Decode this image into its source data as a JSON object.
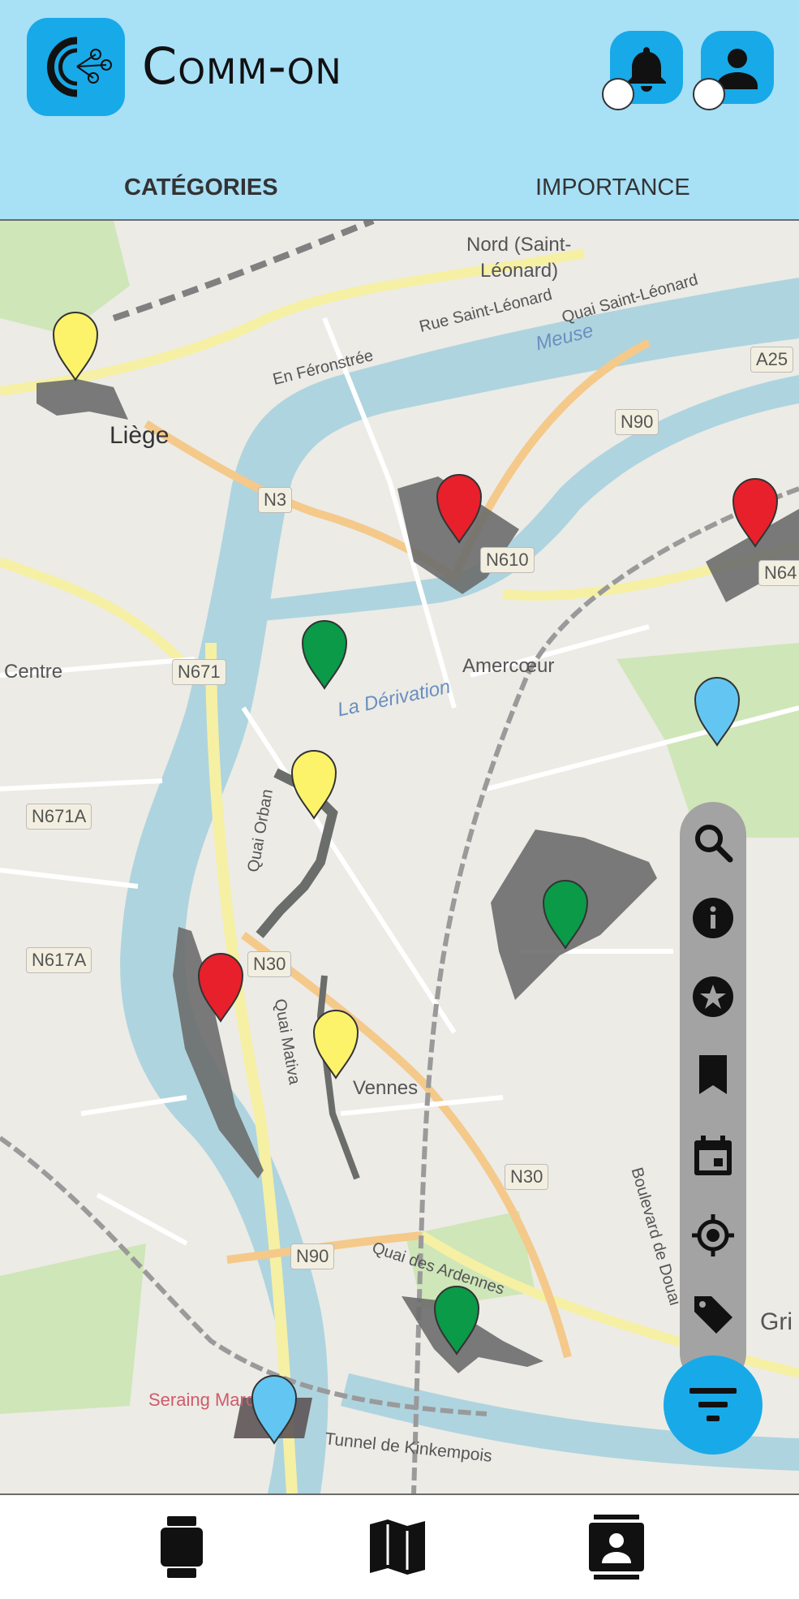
{
  "app": {
    "title": "Comm-on"
  },
  "header": {
    "tabs": [
      {
        "label": "Catégories",
        "active": true
      },
      {
        "label": "Importance",
        "active": false
      }
    ]
  },
  "map": {
    "labels": {
      "liege": "Liège",
      "centre": "Centre",
      "nord": "Nord (Saint-",
      "nord2": "Léonard)",
      "amercoeur": "Amercœur",
      "vennes": "Vennes",
      "derivation": "La Dérivation",
      "meuse": "Meuse",
      "quai_orban": "Quai Orban",
      "quai_mativa": "Quai Mativa",
      "rue_st_leonard": "Rue Saint-Léonard",
      "quai_st_leonard": "Quai Saint-Léonard",
      "en_feronstree": "En Féronstrée",
      "seraing": "Seraing March",
      "tunnel": "Tunnel de Kinkempois",
      "boulevard_douai": "Boulevard de Douai",
      "quai_ardennes": "Quai des Ardennes",
      "gri": "Gri"
    },
    "roads": [
      "A25",
      "N90",
      "N3",
      "N610",
      "N671",
      "N671A",
      "N617A",
      "N30",
      "N30",
      "N90",
      "N64"
    ],
    "marker_colors": {
      "yellow": "#fdf36a",
      "red": "#e8202b",
      "green": "#0a9a48",
      "blue": "#63c6f2"
    },
    "markers": [
      "yellow",
      "red",
      "red",
      "green",
      "blue",
      "yellow",
      "green",
      "red",
      "yellow",
      "green",
      "blue"
    ]
  },
  "tools": [
    "search-icon",
    "info-icon",
    "star-icon",
    "bookmark-icon",
    "calendar-icon",
    "target-icon",
    "tag-icon"
  ],
  "bottom_nav": [
    "watch-icon",
    "map-icon",
    "contact-card-icon"
  ],
  "colors": {
    "accent": "#18a9e8",
    "header_bg": "#a8e0f6",
    "tool_bg": "#a3a3a3"
  }
}
